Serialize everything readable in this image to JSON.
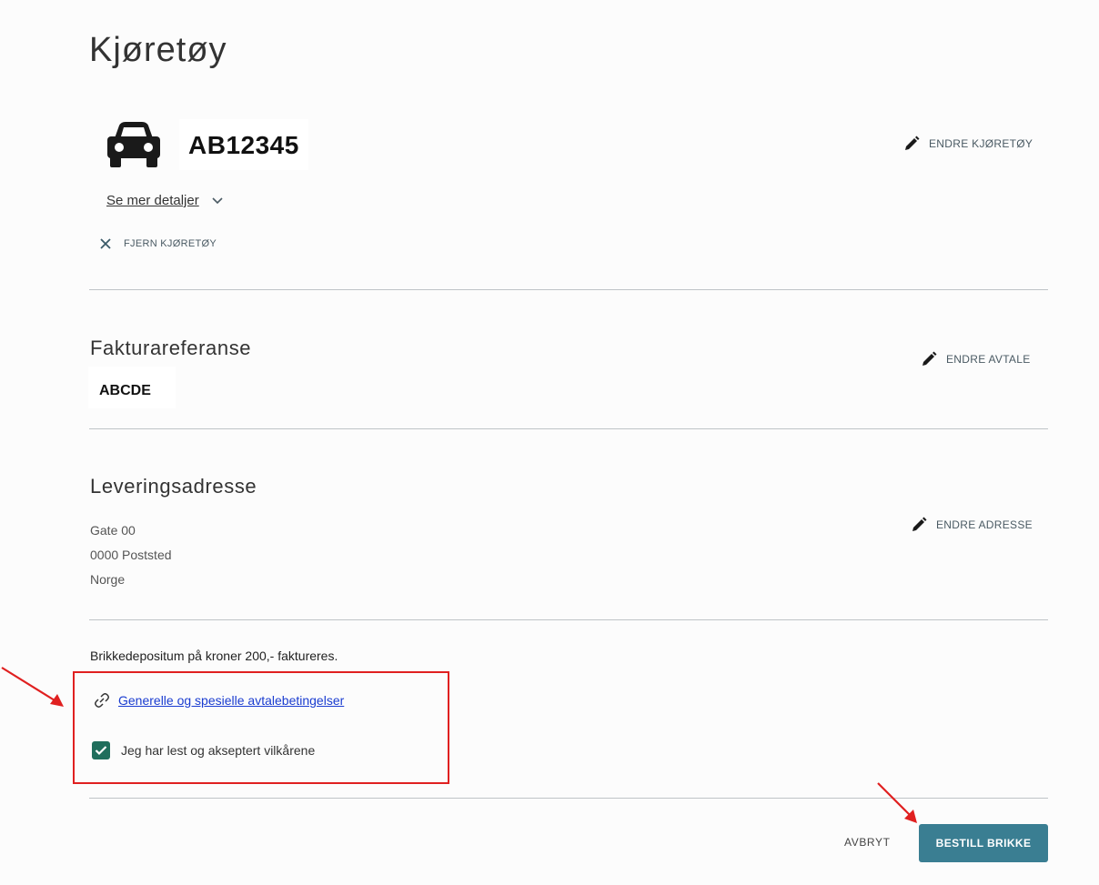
{
  "page_title": "Kjøretøy",
  "vehicle": {
    "plate": "AB12345",
    "edit_label": "ENDRE KJØRETØY",
    "details_label": "Se mer detaljer",
    "remove_label": "FJERN KJØRETØY",
    "icon": "car-icon"
  },
  "invoice_reference": {
    "title": "Fakturareferanse",
    "value": "ABCDE",
    "edit_label": "ENDRE AVTALE"
  },
  "delivery_address": {
    "title": "Leveringsadresse",
    "lines": [
      "Gate 00",
      "0000 Poststed",
      "Norge"
    ],
    "edit_label": "ENDRE ADRESSE"
  },
  "deposit_text": "Brikkedepositum på kroner 200,- faktureres.",
  "terms": {
    "link_label": "Generelle og spesielle avtalebetingelser",
    "accept_label": "Jeg har lest og akseptert vilkårene",
    "accepted": true
  },
  "actions": {
    "cancel_label": "AVBRYT",
    "order_label": "BESTILL BRIKKE"
  },
  "colors": {
    "primary_button": "#3a7e92",
    "checkbox": "#1f6e5c",
    "highlight": "#e02020",
    "link": "#1a3cd0"
  }
}
